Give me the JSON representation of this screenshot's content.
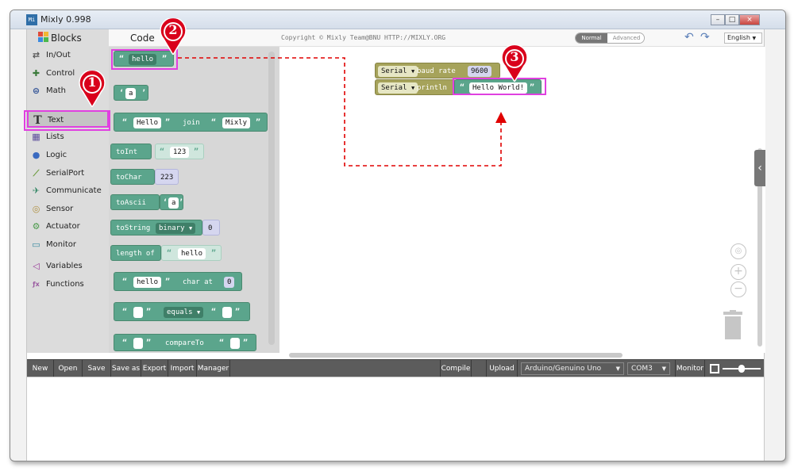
{
  "window": {
    "title": "Mixly 0.998",
    "app_icon_text": "Mi"
  },
  "topbar": {
    "blocks_tab": "Blocks",
    "code_tab": "Code",
    "copyright": "Copyright © Mixly Team@BNU HTTP://MIXLY.ORG",
    "mode_normal": "Normal",
    "mode_advanced": "Advanced",
    "language": "English"
  },
  "sidebar": {
    "items": [
      {
        "label": "In/Out",
        "icon": "arrows-icon",
        "color": "#555555"
      },
      {
        "label": "Control",
        "icon": "gamepad-icon",
        "color": "#3a7a3a"
      },
      {
        "label": "Math",
        "icon": "math-icon",
        "color": "#3a5a9a"
      },
      {
        "label": "Text",
        "icon": "text-icon",
        "color": "#333333"
      },
      {
        "label": "Lists",
        "icon": "lists-icon",
        "color": "#5a4a9a"
      },
      {
        "label": "Logic",
        "icon": "bulb-icon",
        "color": "#3a6ac0"
      },
      {
        "label": "SerialPort",
        "icon": "serial-icon",
        "color": "#6a9a3a"
      },
      {
        "label": "Communicate",
        "icon": "antenna-icon",
        "color": "#3a8a6a"
      },
      {
        "label": "Sensor",
        "icon": "sensor-icon",
        "color": "#b09040"
      },
      {
        "label": "Actuator",
        "icon": "actuator-icon",
        "color": "#4a9a4a"
      },
      {
        "label": "Monitor",
        "icon": "monitor-icon",
        "color": "#3a8aa0"
      },
      {
        "label": "Variables",
        "icon": "variables-icon",
        "color": "#9a3a9a"
      },
      {
        "label": "Functions",
        "icon": "functions-icon",
        "color": "#9a5aa0"
      }
    ]
  },
  "flyout": {
    "b1": {
      "text": "hello"
    },
    "b2": {
      "text": "a"
    },
    "b3": {
      "left": "Hello",
      "op": "join",
      "right": "Mixly"
    },
    "b4": {
      "op": "toInt",
      "value": "123"
    },
    "b5": {
      "op": "toChar",
      "value": "223"
    },
    "b6": {
      "op": "toAscii",
      "value": "a"
    },
    "b7": {
      "op": "toString",
      "mode": "binary",
      "value": "0"
    },
    "b8": {
      "op": "length of",
      "value": "hello"
    },
    "b9": {
      "value": "hello",
      "op": "char at",
      "index": "0"
    },
    "b10": {
      "op": "equals"
    },
    "b11": {
      "op": "compareTo"
    }
  },
  "workspace": {
    "serial1": {
      "obj": "Serial",
      "label": "baud rate",
      "value": "9600"
    },
    "serial2": {
      "obj": "Serial",
      "label": "println",
      "value": "Hello World!"
    }
  },
  "callouts": {
    "one": "1",
    "two": "2",
    "three": "3",
    "color": "#d9001b"
  },
  "bottombar": {
    "new": "New",
    "open": "Open",
    "save": "Save",
    "save_as": "Save as",
    "export": "Export",
    "import": "Import",
    "manager": "Manager",
    "compile": "Compile",
    "upload": "Upload",
    "board": "Arduino/Genuino Uno",
    "port": "COM3",
    "monitor": "Monitor"
  }
}
